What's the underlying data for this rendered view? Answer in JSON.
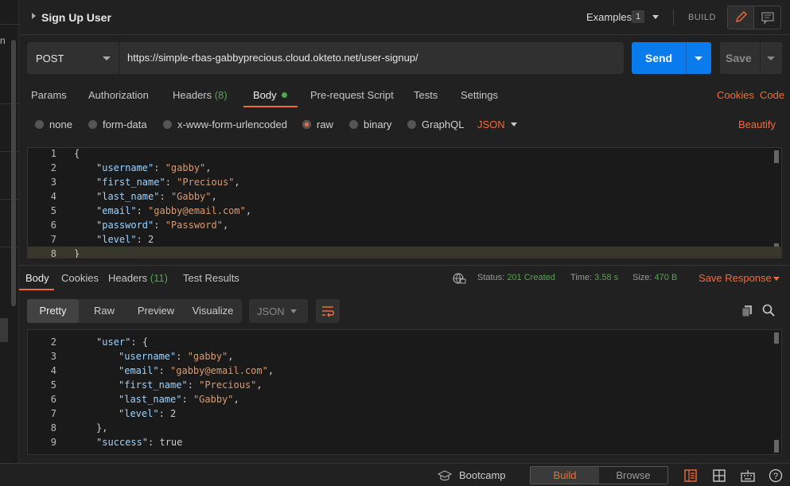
{
  "request": {
    "title": "Sign Up User",
    "examples_label": "Examples",
    "examples_count": "1",
    "build_label": "BUILD",
    "method": "POST",
    "url": "https://simple-rbas-gabbyprecious.cloud.okteto.net/user-signup/",
    "send_label": "Send",
    "save_label": "Save"
  },
  "request_tabs": [
    {
      "label": "Params"
    },
    {
      "label": "Authorization"
    },
    {
      "label": "Headers",
      "count": "(8)"
    },
    {
      "label": "Body"
    },
    {
      "label": "Pre-request Script"
    },
    {
      "label": "Tests"
    },
    {
      "label": "Settings"
    }
  ],
  "links": {
    "cookies": "Cookies",
    "code": "Code",
    "beautify": "Beautify"
  },
  "body_types": [
    "none",
    "form-data",
    "x-www-form-urlencoded",
    "raw",
    "binary",
    "GraphQL"
  ],
  "body_selected": "raw",
  "body_language": "JSON",
  "request_body": [
    {
      "n": "1",
      "text": "{"
    },
    {
      "n": "2",
      "key": "username",
      "value": "gabby",
      "kind": "str",
      "indent": 1,
      "comma": true
    },
    {
      "n": "3",
      "key": "first_name",
      "value": "Precious",
      "kind": "str",
      "indent": 1,
      "comma": true
    },
    {
      "n": "4",
      "key": "last_name",
      "value": "Gabby",
      "kind": "str",
      "indent": 1,
      "comma": true
    },
    {
      "n": "5",
      "key": "email",
      "value": "gabby@email.com",
      "kind": "str",
      "indent": 1,
      "comma": true
    },
    {
      "n": "6",
      "key": "password",
      "value": "Password",
      "kind": "str",
      "indent": 1,
      "comma": true
    },
    {
      "n": "7",
      "key": "level",
      "value": "2",
      "kind": "num",
      "indent": 1,
      "comma": false
    },
    {
      "n": "8",
      "text": "}"
    }
  ],
  "response_tabs": [
    {
      "label": "Body"
    },
    {
      "label": "Cookies"
    },
    {
      "label": "Headers",
      "count": "(11)"
    },
    {
      "label": "Test Results"
    }
  ],
  "response_meta": {
    "status_label": "Status:",
    "status_value": "201 Created",
    "time_label": "Time:",
    "time_value": "3.58 s",
    "size_label": "Size:",
    "size_value": "470 B",
    "save_response": "Save Response"
  },
  "view_modes": [
    "Pretty",
    "Raw",
    "Preview",
    "Visualize"
  ],
  "response_format": "JSON",
  "response_body": [
    {
      "n": "2",
      "key": "user",
      "open": "{",
      "indent": 1
    },
    {
      "n": "3",
      "key": "username",
      "value": "gabby",
      "kind": "str",
      "indent": 2,
      "comma": true
    },
    {
      "n": "4",
      "key": "email",
      "value": "gabby@email.com",
      "kind": "str",
      "indent": 2,
      "comma": true
    },
    {
      "n": "5",
      "key": "first_name",
      "value": "Precious",
      "kind": "str",
      "indent": 2,
      "comma": true
    },
    {
      "n": "6",
      "key": "last_name",
      "value": "Gabby",
      "kind": "str",
      "indent": 2,
      "comma": true
    },
    {
      "n": "7",
      "key": "level",
      "value": "2",
      "kind": "num",
      "indent": 2,
      "comma": false
    },
    {
      "n": "8",
      "text": "},",
      "indent": 1
    },
    {
      "n": "9",
      "key": "success",
      "value": "true",
      "kind": "num",
      "indent": 1,
      "comma": false
    }
  ],
  "status_bar": {
    "bootcamp": "Bootcamp",
    "build": "Build",
    "browse": "Browse"
  },
  "colors": {
    "accent": "#f26b3a",
    "send_blue": "#097bed",
    "success_green": "#53a54f",
    "json_key": "#9cd3ff",
    "json_string": "#d99b74"
  }
}
